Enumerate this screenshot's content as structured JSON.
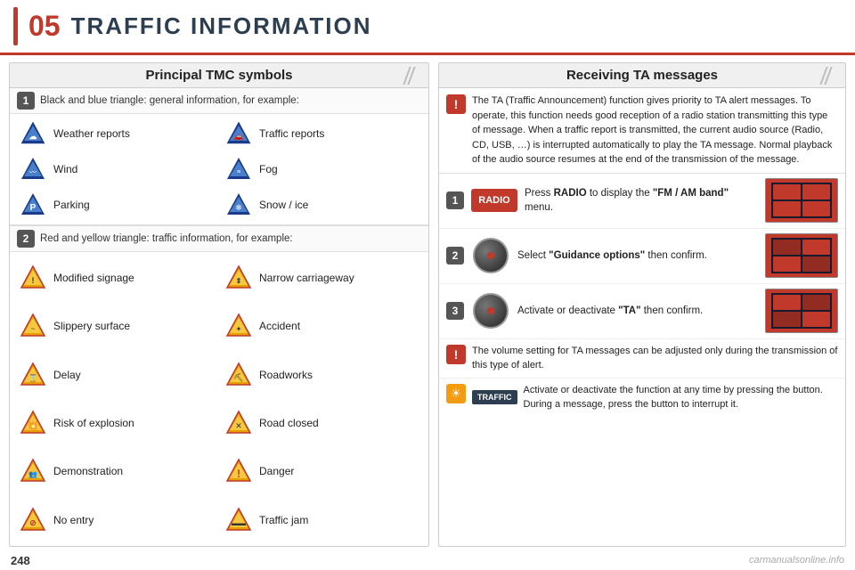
{
  "header": {
    "chapter_num": "05",
    "chapter_title": "TRAFFIC INFORMATION"
  },
  "left_panel": {
    "title": "Principal TMC symbols",
    "section1": {
      "badge": "1",
      "description": "Black and blue triangle: general information, for example:",
      "items_left": [
        {
          "label": "Weather reports",
          "icon_type": "blue_triangle",
          "icon_inner": "cloud"
        },
        {
          "label": "Wind",
          "icon_type": "blue_triangle",
          "icon_inner": "wind"
        },
        {
          "label": "Parking",
          "icon_type": "blue_triangle",
          "icon_inner": "P"
        }
      ],
      "items_right": [
        {
          "label": "Traffic reports",
          "icon_type": "blue_triangle",
          "icon_inner": "car"
        },
        {
          "label": "Fog",
          "icon_type": "blue_triangle",
          "icon_inner": "fog"
        },
        {
          "label": "Snow / ice",
          "icon_type": "blue_triangle",
          "icon_inner": "snow"
        }
      ]
    },
    "section2": {
      "badge": "2",
      "description": "Red and yellow triangle: traffic information, for example:",
      "items_left": [
        {
          "label": "Modified signage",
          "icon_type": "red_triangle",
          "icon_inner": "sign"
        },
        {
          "label": "Slippery surface",
          "icon_type": "red_triangle",
          "icon_inner": "slip"
        },
        {
          "label": "Delay",
          "icon_type": "red_triangle",
          "icon_inner": "delay"
        },
        {
          "label": "Risk of explosion",
          "icon_type": "red_triangle",
          "icon_inner": "explosion"
        },
        {
          "label": "Demonstration",
          "icon_type": "red_triangle",
          "icon_inner": "demo"
        },
        {
          "label": "No entry",
          "icon_type": "red_triangle",
          "icon_inner": "noentry"
        }
      ],
      "items_right": [
        {
          "label": "Narrow carriageway",
          "icon_type": "red_triangle",
          "icon_inner": "narrow"
        },
        {
          "label": "Accident",
          "icon_type": "red_triangle",
          "icon_inner": "accident"
        },
        {
          "label": "Roadworks",
          "icon_type": "red_triangle",
          "icon_inner": "roadworks"
        },
        {
          "label": "Road closed",
          "icon_type": "red_triangle",
          "icon_inner": "closed"
        },
        {
          "label": "Danger",
          "icon_type": "red_triangle",
          "icon_inner": "danger"
        },
        {
          "label": "Traffic jam",
          "icon_type": "red_triangle",
          "icon_inner": "jam"
        }
      ]
    }
  },
  "right_panel": {
    "title": "Receiving TA messages",
    "info_text": "The TA (Traffic Announcement) function gives priority to TA alert messages. To operate, this function needs good reception of a radio station transmitting this type of message. When a traffic report is transmitted, the current audio source (Radio, CD, USB, …) is interrupted automatically to play the TA message. Normal playback of the audio source resumes at the end of the transmission of the message.",
    "steps": [
      {
        "badge": "1",
        "button_label": "RADIO",
        "text": "Press RADIO to display the \"FM / AM band\" menu.",
        "bold_parts": [
          "RADIO",
          "FM / AM band"
        ]
      },
      {
        "badge": "2",
        "text": "Select \"Guidance options\" then confirm.",
        "bold_parts": [
          "Guidance options"
        ]
      },
      {
        "badge": "3",
        "text": "Activate or deactivate \"TA\" then confirm.",
        "bold_parts": [
          "TA"
        ]
      }
    ],
    "volume_tip": "The volume setting for TA messages can be adjusted only during the transmission of this type of alert.",
    "traffic_tip_button": "TRAFFIC",
    "traffic_tip_text": "Activate or deactivate the function at any time by pressing the button.\nDuring a message, press the button to interrupt it."
  },
  "footer": {
    "page_number": "248",
    "brand": "carmanualsonline.info"
  }
}
